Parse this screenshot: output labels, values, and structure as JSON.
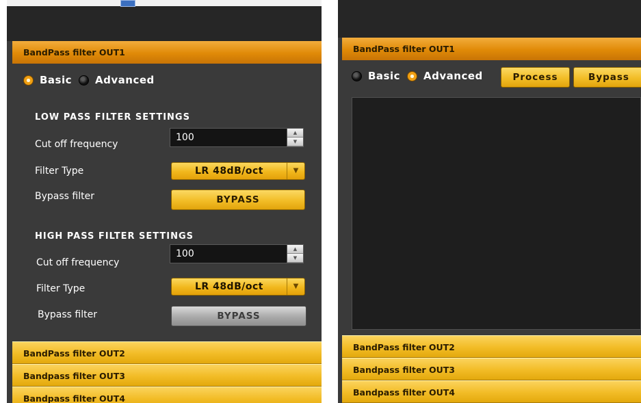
{
  "left_panel": {
    "active_section": "BandPass filter OUT1",
    "mode": {
      "basic_label": "Basic",
      "advanced_label": "Advanced",
      "selected": "Basic"
    },
    "low_pass": {
      "title": "LOW PASS FILTER SETTINGS",
      "cutoff_label": "Cut off frequency",
      "cutoff_value": "100",
      "filter_type_label": "Filter Type",
      "filter_type_value": "LR 48dB/oct",
      "bypass_label": "Bypass filter",
      "bypass_button": "BYPASS"
    },
    "high_pass": {
      "title": "HIGH PASS FILTER SETTINGS",
      "cutoff_label": "Cut off frequency",
      "cutoff_value": "100",
      "filter_type_label": "Filter Type",
      "filter_type_value": "LR 48dB/oct",
      "bypass_label": "Bypass filter",
      "bypass_button": "BYPASS"
    },
    "collapsed_sections": [
      "BandPass filter OUT2",
      "Bandpass filter OUT3",
      "Bandpass filter OUT4"
    ]
  },
  "right_panel": {
    "active_section": "BandPass filter OUT1",
    "mode": {
      "basic_label": "Basic",
      "advanced_label": "Advanced",
      "selected": "Advanced"
    },
    "process_button": "Process",
    "bypass_button": "Bypass",
    "collapsed_sections": [
      "BandPass filter OUT2",
      "Bandpass filter OUT3",
      "Bandpass filter OUT4"
    ]
  },
  "colors": {
    "panel_bg": "#3a3a3a",
    "topbar_bg": "#262626",
    "accent_orange": "#e08a07",
    "accent_yellow": "#f2bc26",
    "button_gray": "#a9a9a9"
  },
  "icons": {
    "spin_up": "spin-up-icon",
    "spin_down": "spin-down-icon",
    "dropdown": "chevron-down-icon"
  }
}
